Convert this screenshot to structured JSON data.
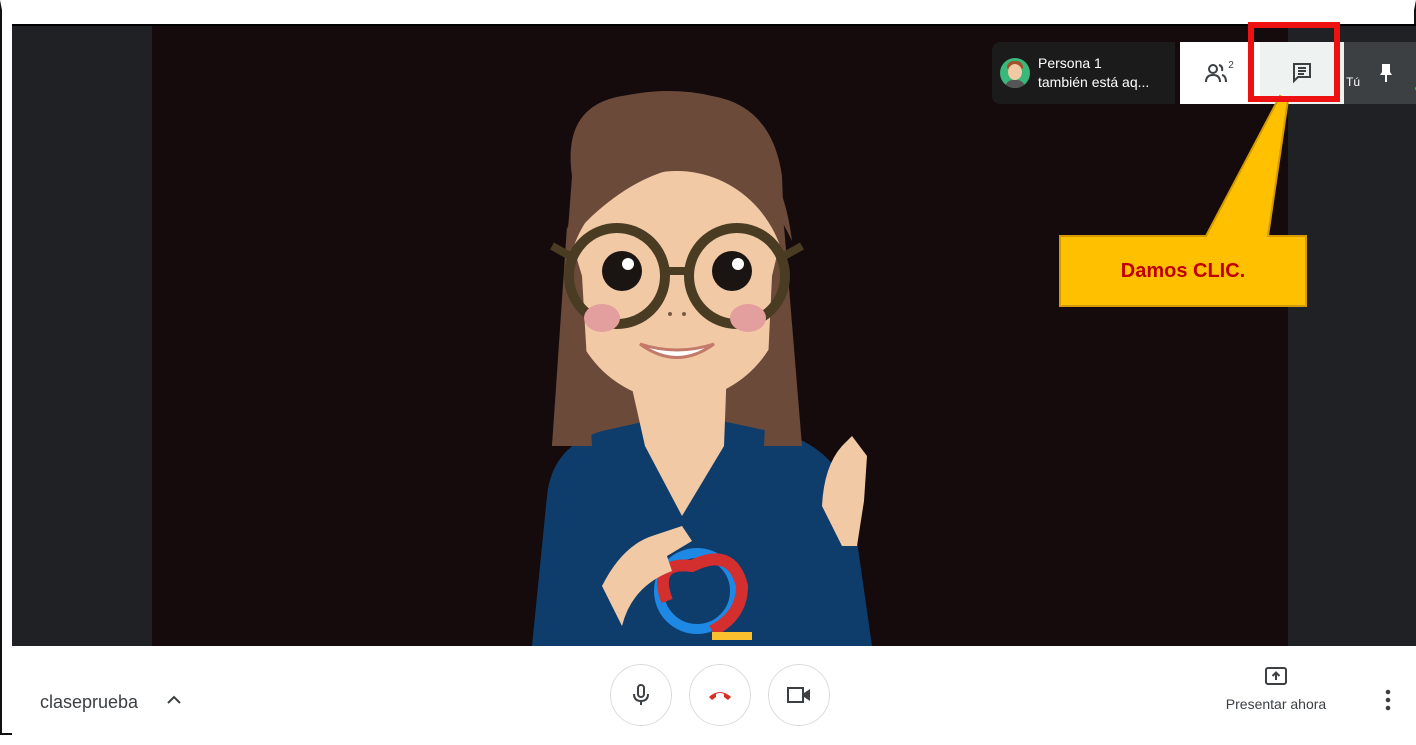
{
  "notification": {
    "name": "Persona 1",
    "message": "también está aq..."
  },
  "top_controls": {
    "people_count": "2",
    "people_icon": "people-icon",
    "chat_icon": "chat-icon",
    "you_label": "Tú",
    "pin_icon": "pin-icon"
  },
  "annotation": {
    "callout_text": "Damos CLIC.",
    "highlight_color": "#ee1111",
    "callout_color": "#ffc000",
    "callout_text_color": "#c00000"
  },
  "bottom_bar": {
    "meeting_name": "claseprueba",
    "caret_icon": "chevron-up-icon",
    "mic_icon": "microphone-icon",
    "hangup_icon": "hangup-icon",
    "camera_icon": "camera-icon",
    "present_icon": "present-screen-icon",
    "present_label": "Presentar ahora",
    "more_icon": "more-vertical-icon"
  }
}
